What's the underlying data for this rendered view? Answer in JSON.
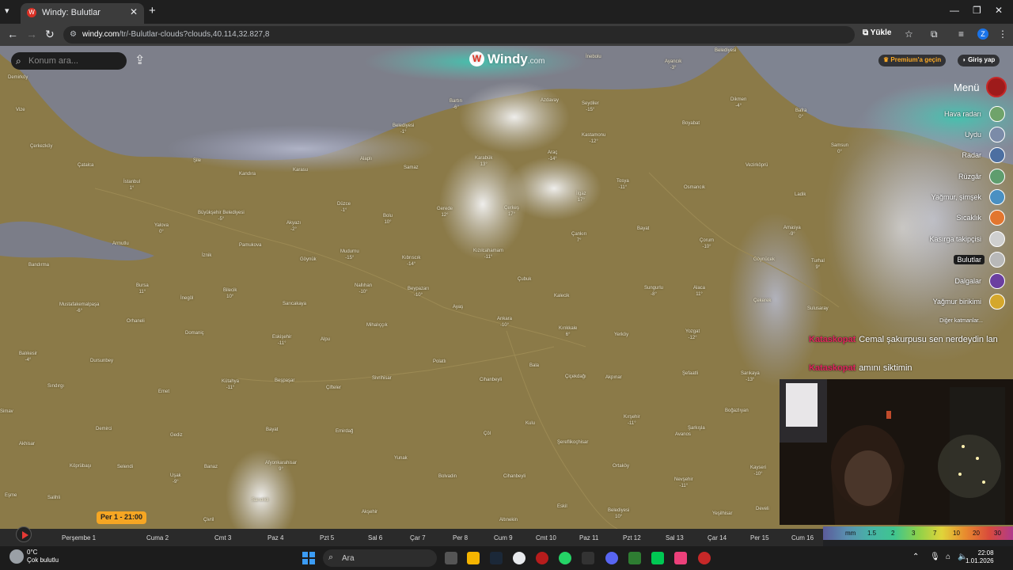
{
  "browser": {
    "tab_title": "Windy: Bulutlar",
    "url_domain": "windy.com",
    "url_path": "/tr/-Bulutlar-clouds?clouds,40.114,32.827,8",
    "install_label": "Yükle",
    "profile_initial": "Z"
  },
  "toolbar": {
    "search_placeholder": "Konum ara...",
    "logo": "Windy",
    "logo_suffix": ".com",
    "premium": "Premium'a geçin",
    "login": "Giriş yap",
    "menu": "Menü"
  },
  "layers": [
    {
      "label": "Hava radarı",
      "color": "#6fa36a",
      "active": false
    },
    {
      "label": "Uydu",
      "color": "#7b8ba8",
      "active": false
    },
    {
      "label": "Radar",
      "color": "#4c6fa1",
      "active": false
    },
    {
      "label": "Rüzgâr",
      "color": "#5f9d6e",
      "active": false
    },
    {
      "label": "Yağmur, şimşek",
      "color": "#4a90c2",
      "active": false
    },
    {
      "label": "Sıcaklık",
      "color": "#e2762f",
      "active": false
    },
    {
      "label": "Kasırga takipçisi",
      "color": "#cfcfcf",
      "active": false
    },
    {
      "label": "Bulutlar",
      "color": "#b8b8b8",
      "active": true
    },
    {
      "label": "Dalgalar",
      "color": "#6b3fa0",
      "active": false
    },
    {
      "label": "Yağmur birikimi",
      "color": "#d4a72c",
      "active": false
    },
    {
      "label": "Diğer katmanlar...",
      "color": "",
      "active": false
    }
  ],
  "chat": [
    {
      "user": "Kataskopat",
      "msg": "Cemal şakurpusu sen nerdeydin lan"
    },
    {
      "user": "Kataskopat",
      "msg": "amını siktimin"
    }
  ],
  "cities": [
    {
      "name": "Demirköy",
      "temp": "",
      "big": false
    },
    {
      "name": "Bartın",
      "temp": "-6°",
      "big": false
    },
    {
      "name": "Ayancık",
      "temp": "-3°",
      "big": false
    },
    {
      "name": "İnebolu",
      "temp": "",
      "big": false
    },
    {
      "name": "Belediyesi",
      "temp": "",
      "big": false
    },
    {
      "name": "Azdavay",
      "temp": "",
      "big": false
    },
    {
      "name": "Seydiler",
      "temp": "-15°",
      "big": false
    },
    {
      "name": "Dikmen",
      "temp": "-4°",
      "big": false
    },
    {
      "name": "Bafra",
      "temp": "0°",
      "big": false
    },
    {
      "name": "Vize",
      "temp": "",
      "big": false
    },
    {
      "name": "Belediyesi",
      "temp": "-1°",
      "big": false
    },
    {
      "name": "Kastamonu",
      "temp": "-12°",
      "big": true
    },
    {
      "name": "Boyabat",
      "temp": "",
      "big": false
    },
    {
      "name": "Samsun",
      "temp": "0°",
      "big": true
    },
    {
      "name": "Çerkezköy",
      "temp": "",
      "big": false
    },
    {
      "name": "Karabük",
      "temp": "13°",
      "big": false
    },
    {
      "name": "Araç",
      "temp": "-14°",
      "big": false
    },
    {
      "name": "Çatalca",
      "temp": "",
      "big": false
    },
    {
      "name": "Şile",
      "temp": "",
      "big": false
    },
    {
      "name": "Alaplı",
      "temp": "",
      "big": false
    },
    {
      "name": "Samaz",
      "temp": "",
      "big": false
    },
    {
      "name": "Kandıra",
      "temp": "",
      "big": false
    },
    {
      "name": "Karasu",
      "temp": "",
      "big": false
    },
    {
      "name": "Vezirköprü",
      "temp": "",
      "big": false
    },
    {
      "name": "İstanbul",
      "temp": "1°",
      "big": true
    },
    {
      "name": "Tosya",
      "temp": "-11°",
      "big": false
    },
    {
      "name": "Osmancık",
      "temp": "",
      "big": false
    },
    {
      "name": "İlgaz",
      "temp": "17°",
      "big": false
    },
    {
      "name": "Ladik",
      "temp": "",
      "big": false
    },
    {
      "name": "Düzce",
      "temp": "-1°",
      "big": true
    },
    {
      "name": "Gerede",
      "temp": "12°",
      "big": false
    },
    {
      "name": "Çerkeş",
      "temp": "17°",
      "big": false
    },
    {
      "name": "Büyükşehir Belediyesi",
      "temp": "-5°",
      "big": true
    },
    {
      "name": "Akyazı",
      "temp": "-2°",
      "big": false
    },
    {
      "name": "Bolu",
      "temp": "10°",
      "big": true
    },
    {
      "name": "Yalova",
      "temp": "0°",
      "big": true
    },
    {
      "name": "Çankırı",
      "temp": "7°",
      "big": true
    },
    {
      "name": "Bayat",
      "temp": "",
      "big": false
    },
    {
      "name": "Çorum",
      "temp": "-10°",
      "big": true
    },
    {
      "name": "Amasya",
      "temp": "-9°",
      "big": true
    },
    {
      "name": "Armutlu",
      "temp": "",
      "big": false
    },
    {
      "name": "Pamukova",
      "temp": "",
      "big": false
    },
    {
      "name": "Mudurnu",
      "temp": "-15°",
      "big": false
    },
    {
      "name": "Kızılcahamam",
      "temp": "-11°",
      "big": false
    },
    {
      "name": "Göynük",
      "temp": "",
      "big": false
    },
    {
      "name": "Kıbrıscık",
      "temp": "-14°",
      "big": false
    },
    {
      "name": "Bandırma",
      "temp": "",
      "big": false
    },
    {
      "name": "İznik",
      "temp": "",
      "big": false
    },
    {
      "name": "Göynücek",
      "temp": "",
      "big": false
    },
    {
      "name": "Turhal",
      "temp": "9°",
      "big": false
    },
    {
      "name": "Bursa",
      "temp": "11°",
      "big": true
    },
    {
      "name": "Bilecik",
      "temp": "10°",
      "big": true
    },
    {
      "name": "Nallıhan",
      "temp": "-10°",
      "big": false
    },
    {
      "name": "Beypazarı",
      "temp": "-10°",
      "big": false
    },
    {
      "name": "Çubuk",
      "temp": "",
      "big": false
    },
    {
      "name": "Sungurlu",
      "temp": "-8°",
      "big": false
    },
    {
      "name": "Alaca",
      "temp": "11°",
      "big": false
    },
    {
      "name": "Kalecik",
      "temp": "",
      "big": false
    },
    {
      "name": "Mustafakemalpaşa",
      "temp": "-6°",
      "big": false
    },
    {
      "name": "İnegöl",
      "temp": "",
      "big": false
    },
    {
      "name": "Sarıcakaya",
      "temp": "",
      "big": false
    },
    {
      "name": "Ayaş",
      "temp": "",
      "big": false
    },
    {
      "name": "Çekerek",
      "temp": "",
      "big": false
    },
    {
      "name": "Sulusaray",
      "temp": "",
      "big": false
    },
    {
      "name": "Ankara",
      "temp": "-10°",
      "big": true
    },
    {
      "name": "Orhaneli",
      "temp": "",
      "big": false
    },
    {
      "name": "Mihalıççık",
      "temp": "",
      "big": false
    },
    {
      "name": "Kırıkkale",
      "temp": "6°",
      "big": true
    },
    {
      "name": "Domaniç",
      "temp": "",
      "big": false
    },
    {
      "name": "Eskişehir",
      "temp": "-11°",
      "big": true
    },
    {
      "name": "Alpu",
      "temp": "",
      "big": false
    },
    {
      "name": "Yerköy",
      "temp": "",
      "big": false
    },
    {
      "name": "Yozgat",
      "temp": "-12°",
      "big": true
    },
    {
      "name": "Balıkesir",
      "temp": "-4°",
      "big": true
    },
    {
      "name": "Dursunbey",
      "temp": "",
      "big": false
    },
    {
      "name": "Polatlı",
      "temp": "",
      "big": false
    },
    {
      "name": "Bala",
      "temp": "",
      "big": false
    },
    {
      "name": "Şefaatli",
      "temp": "",
      "big": false
    },
    {
      "name": "Sarıkaya",
      "temp": "-13°",
      "big": false
    },
    {
      "name": "Kütahya",
      "temp": "-11°",
      "big": true
    },
    {
      "name": "Beşpaşar",
      "temp": "",
      "big": false
    },
    {
      "name": "Çifteler",
      "temp": "",
      "big": false
    },
    {
      "name": "Sivrihisar",
      "temp": "",
      "big": false
    },
    {
      "name": "Çiçekdağı",
      "temp": "",
      "big": false
    },
    {
      "name": "Akpınar",
      "temp": "",
      "big": false
    },
    {
      "name": "Emet",
      "temp": "",
      "big": false
    },
    {
      "name": "Sındırgı",
      "temp": "",
      "big": false
    },
    {
      "name": "Cihanbeyli",
      "temp": "",
      "big": false
    },
    {
      "name": "Kırşehir",
      "temp": "-11°",
      "big": true
    },
    {
      "name": "Boğazlıyan",
      "temp": "",
      "big": false
    },
    {
      "name": "Simav",
      "temp": "",
      "big": false
    },
    {
      "name": "Gediz",
      "temp": "",
      "big": false
    },
    {
      "name": "Emirdağ",
      "temp": "",
      "big": false
    },
    {
      "name": "Çöl",
      "temp": "",
      "big": false
    },
    {
      "name": "Kulu",
      "temp": "",
      "big": false
    },
    {
      "name": "Şarkışla",
      "temp": "",
      "big": false
    },
    {
      "name": "Demirci",
      "temp": "",
      "big": false
    },
    {
      "name": "Bayat",
      "temp": "",
      "big": false
    },
    {
      "name": "Şereflikoçhisar",
      "temp": "",
      "big": false
    },
    {
      "name": "Avanos",
      "temp": "",
      "big": false
    },
    {
      "name": "Akhisar",
      "temp": "",
      "big": false
    },
    {
      "name": "Yunak",
      "temp": "",
      "big": false
    },
    {
      "name": "Afyonkarahisar",
      "temp": "9°",
      "big": true
    },
    {
      "name": "Kayseri",
      "temp": "-10°",
      "big": true
    },
    {
      "name": "Uşak",
      "temp": "-9°",
      "big": true
    },
    {
      "name": "Köprübaşı",
      "temp": "",
      "big": false
    },
    {
      "name": "Selendi",
      "temp": "",
      "big": false
    },
    {
      "name": "Banaz",
      "temp": "",
      "big": false
    },
    {
      "name": "Bolvadin",
      "temp": "",
      "big": false
    },
    {
      "name": "Cihanbeyli",
      "temp": "",
      "big": false
    },
    {
      "name": "Ortaköy",
      "temp": "",
      "big": false
    },
    {
      "name": "Nevşehir",
      "temp": "-11°",
      "big": true
    },
    {
      "name": "Salihli",
      "temp": "",
      "big": false
    },
    {
      "name": "Sandıklı",
      "temp": "",
      "big": false
    },
    {
      "name": "Akşehir",
      "temp": "",
      "big": false
    },
    {
      "name": "Eşme",
      "temp": "",
      "big": false
    },
    {
      "name": "Çivril",
      "temp": "",
      "big": false
    },
    {
      "name": "Altınekin",
      "temp": "",
      "big": false
    },
    {
      "name": "Eskil",
      "temp": "",
      "big": false
    },
    {
      "name": "Belediyesi",
      "temp": "10°",
      "big": true
    },
    {
      "name": "Yeşilhisar",
      "temp": "",
      "big": false
    },
    {
      "name": "Develi",
      "temp": "",
      "big": false
    }
  ],
  "timeline": {
    "current": "Per 1 - 21:00",
    "days": [
      "Perşembe 1",
      "Cuma 2",
      "Cmt 3",
      "Paz 4",
      "Pzt 5",
      "Sal 6",
      "Çar 7",
      "Per 8",
      "Cum 9",
      "Cmt 10",
      "Paz 11",
      "Pzt 12",
      "Sal 13",
      "Çar 14",
      "Per 15",
      "Cum 16"
    ]
  },
  "scale": {
    "unit": "mm",
    "values": [
      "1.5",
      "2",
      "3",
      "7",
      "10",
      "20",
      "30"
    ]
  },
  "taskbar": {
    "weather_temp": "0°C",
    "weather_desc": "Çok bulutlu",
    "search_placeholder": "Ara",
    "time": "22:08",
    "date": "1.01.2026"
  }
}
